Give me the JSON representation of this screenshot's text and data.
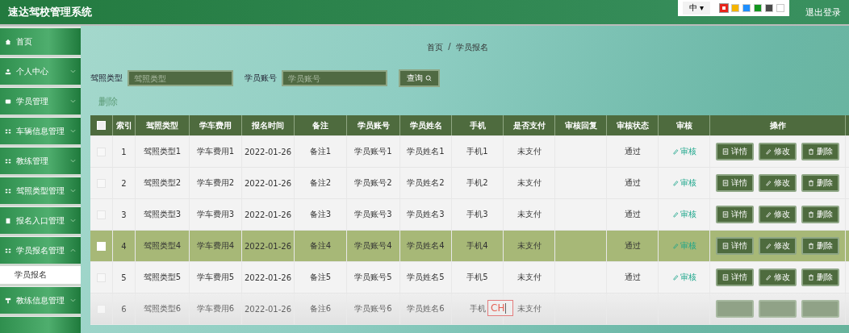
{
  "app_title": "速达驾校管理系统",
  "theme_popup": {
    "language": "中",
    "caret": "▾",
    "swatches": [
      {
        "color": "#e8251b",
        "selected": true
      },
      {
        "color": "#f5b400",
        "selected": false
      },
      {
        "color": "#1e8fff",
        "selected": false
      },
      {
        "color": "#13961f",
        "selected": false
      },
      {
        "color": "#4a4a4a",
        "selected": false
      },
      {
        "color": "#ffffff",
        "selected": false
      }
    ]
  },
  "logout": "退出登录",
  "sidebar": {
    "items": [
      {
        "label": "首页"
      },
      {
        "label": "个人中心",
        "expanded": false
      },
      {
        "label": "学员管理",
        "expanded": false
      },
      {
        "label": "车辆信息管理",
        "expanded": false
      },
      {
        "label": "教练管理",
        "expanded": false
      },
      {
        "label": "驾照类型管理",
        "expanded": false
      },
      {
        "label": "报名入口管理",
        "expanded": false
      },
      {
        "label": "学员报名管理",
        "expanded": true,
        "children": [
          {
            "label": "学员报名"
          }
        ]
      },
      {
        "label": "教练信息管理",
        "expanded": false
      }
    ]
  },
  "breadcrumb": {
    "items": [
      "首页",
      "学员报名"
    ],
    "separator": "/"
  },
  "search": {
    "fields": [
      {
        "label": "驾照类型",
        "placeholder": "驾照类型"
      },
      {
        "label": "学员账号",
        "placeholder": "学员账号"
      }
    ],
    "button": "查询"
  },
  "delete_link": "删除",
  "table": {
    "header_checked": false,
    "columns": [
      "索引",
      "驾照类型",
      "学车费用",
      "报名时间",
      "备注",
      "学员账号",
      "学员姓名",
      "手机",
      "是否支付",
      "审核回复",
      "审核状态",
      "审核",
      "操作"
    ],
    "rows": [
      {
        "selected": false,
        "faded": false,
        "cells": [
          "1",
          "驾照类型1",
          "学车费用1",
          "2022-01-26",
          "备注1",
          "学员账号1",
          "学员姓名1",
          "手机1",
          "未支付"
        ],
        "status": "通过",
        "audit_link": "审核",
        "actions": [
          "详情",
          "修改",
          "删除"
        ]
      },
      {
        "selected": false,
        "faded": false,
        "cells": [
          "2",
          "驾照类型2",
          "学车费用2",
          "2022-01-26",
          "备注2",
          "学员账号2",
          "学员姓名2",
          "手机2",
          "未支付"
        ],
        "status": "通过",
        "audit_link": "审核",
        "actions": [
          "详情",
          "修改",
          "删除"
        ]
      },
      {
        "selected": false,
        "faded": false,
        "cells": [
          "3",
          "驾照类型3",
          "学车费用3",
          "2022-01-26",
          "备注3",
          "学员账号3",
          "学员姓名3",
          "手机3",
          "未支付"
        ],
        "status": "通过",
        "audit_link": "审核",
        "actions": [
          "详情",
          "修改",
          "删除"
        ]
      },
      {
        "selected": true,
        "faded": false,
        "cells": [
          "4",
          "驾照类型4",
          "学车费用4",
          "2022-01-26",
          "备注4",
          "学员账号4",
          "学员姓名4",
          "手机4",
          "未支付"
        ],
        "status": "通过",
        "audit_link": "审核",
        "actions": [
          "详情",
          "修改",
          "删除"
        ]
      },
      {
        "selected": false,
        "faded": false,
        "cells": [
          "5",
          "驾照类型5",
          "学车费用5",
          "2022-01-26",
          "备注5",
          "学员账号5",
          "学员姓名5",
          "手机5",
          "未支付"
        ],
        "status": "通过",
        "audit_link": "审核",
        "actions": [
          "详情",
          "修改",
          "删除"
        ]
      },
      {
        "selected": false,
        "faded": true,
        "cells": [
          "6",
          "驾照类型6",
          "学车费用6",
          "2022-01-26",
          "备注6",
          "学员账号6",
          "学员姓名6",
          "手机",
          "未支付"
        ]
      }
    ]
  },
  "ime_box": {
    "text": "CH"
  }
}
